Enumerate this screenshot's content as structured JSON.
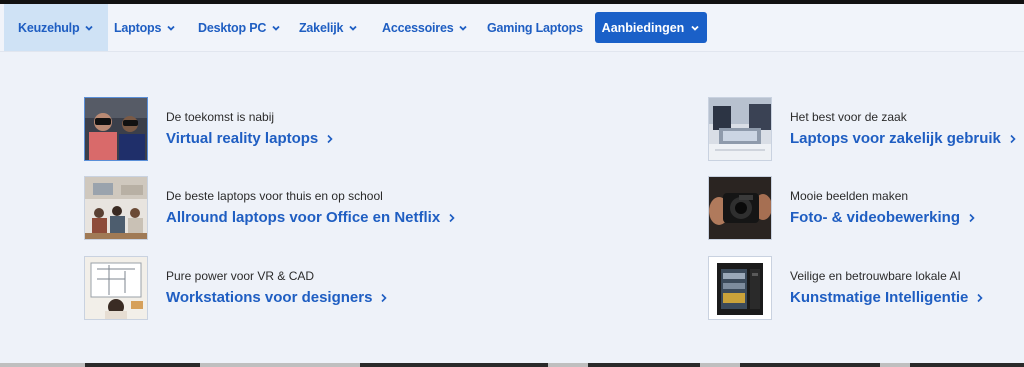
{
  "nav": {
    "items": [
      {
        "label": "Keuzehulp",
        "has_dropdown": true,
        "active": true
      },
      {
        "label": "Laptops",
        "has_dropdown": true
      },
      {
        "label": "Desktop PC",
        "has_dropdown": true
      },
      {
        "label": "Zakelijk",
        "has_dropdown": true
      },
      {
        "label": "Accessoires",
        "has_dropdown": true
      },
      {
        "label": "Gaming Laptops",
        "has_dropdown": false
      }
    ],
    "cta": {
      "label": "Aanbiedingen",
      "icon": "chevron-down-icon",
      "color": "#1a60c8"
    },
    "active_bg": "#cfe2f5",
    "link_color": "#1f5ec2"
  },
  "menu": {
    "left": [
      {
        "subtitle": "De toekomst is nabij",
        "title": "Virtual reality laptops",
        "image": "vr-headset-users"
      },
      {
        "subtitle": "De beste laptops voor thuis en op school",
        "title": "Allround laptops voor Office en Netflix",
        "image": "classroom-students"
      },
      {
        "subtitle": "Pure power voor VR & CAD",
        "title": "Workstations voor designers",
        "image": "architect-blueprint"
      }
    ],
    "right": [
      {
        "subtitle": "Het best voor de zaak",
        "title": "Laptops voor zakelijk gebruik",
        "image": "business-laptop"
      },
      {
        "subtitle": "Mooie beelden maken",
        "title": "Foto- & videobewerking",
        "image": "camera-hands"
      },
      {
        "subtitle": "Veilige en betrouwbare lokale AI",
        "title": "Kunstmatige Intelligentie",
        "image": "server-pc-tower"
      }
    ]
  }
}
